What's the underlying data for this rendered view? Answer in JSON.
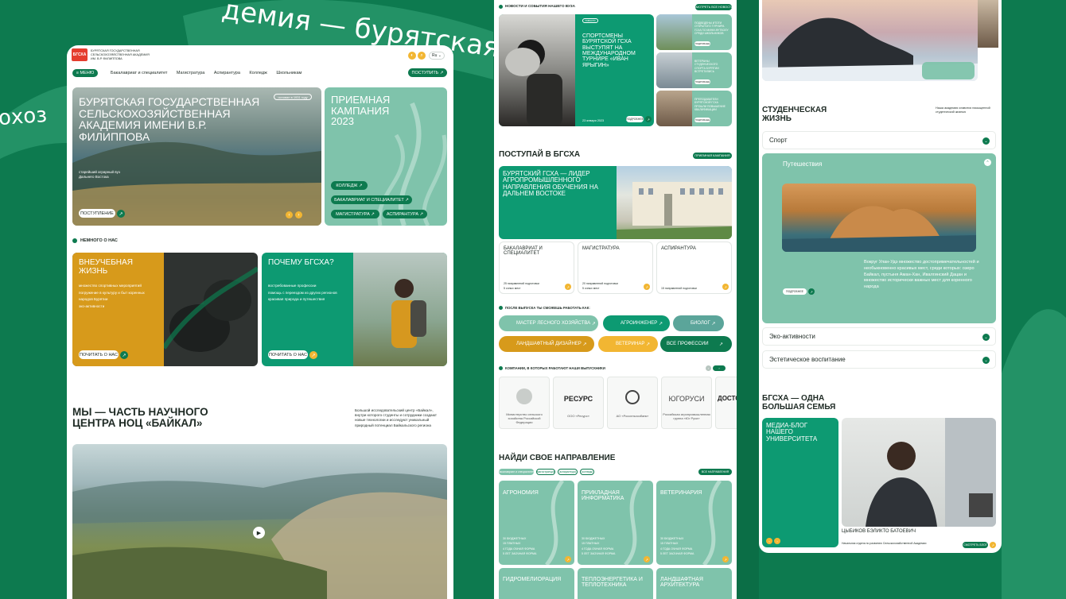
{
  "background": {
    "slogan_top": "демия — бурятская го",
    "slogan_left": "охоз"
  },
  "site": {
    "name_line1": "БУРЯТСКАЯ ГОСУДАРСТВЕННАЯ",
    "name_line2": "СЕЛЬСКОХОЗЯЙСТВЕННАЯ АКАДЕМИЯ",
    "name_line3": "ИМ. В.Р. ФИЛИППОВА",
    "logo_text": "БГСХА",
    "lang": "Ru",
    "accent": "#0d7a4f",
    "orange": "#f2b632",
    "mint": "#7fc3ab"
  },
  "header": {
    "menu_label": "МЕНЮ",
    "nav": [
      "Бакалавриат и специалитет",
      "Магистратура",
      "Аспирантура",
      "Колледж",
      "Школьникам"
    ],
    "apply_label": "ПОСТУПИТЬ"
  },
  "hero": {
    "title": "БУРЯТСКАЯ ГОСУДАРСТВЕННАЯ СЕЛЬСКОХОЗЯЙСТВЕННАЯ АКАДЕМИЯ ИМЕНИ В.Р. ФИЛИППОВА",
    "subtitle": "старейший аграрный вуз Дальнего Востока",
    "badge": "основан в 1931 году",
    "button": "ПОСТУПЛЕНИЕ"
  },
  "campaign": {
    "title": "ПРИЕМНАЯ КАМПАНИЯ 2023",
    "buttons": [
      "КОЛЛЕДЖ",
      "БАКАЛАВРИАТ И СПЕЦИАЛИТЕТ",
      "МАГИСТРАТУРА",
      "АСПИРАНТУРА"
    ]
  },
  "about": {
    "label": "НЕМНОГО О НАС",
    "card1": {
      "title": "ВНЕУЧЕБНАЯ ЖИЗНЬ",
      "items": [
        "множество спортивных мероприятий",
        "погружение в культуру и быт коренных народов Бурятии",
        "эко-активности"
      ],
      "button": "ПОЧИТАТЬ О НАС"
    },
    "card2": {
      "title": "ПОЧЕМУ БГСХА?",
      "items": [
        "востребованные профессии",
        "помощь с переездом из других регионов",
        "красивая природа и путешествия"
      ],
      "button": "ПОЧИТАТЬ О НАС"
    }
  },
  "science": {
    "title": "МЫ — ЧАСТЬ НАУЧНОГО ЦЕНТРА НОЦ «БАЙКАЛ»",
    "text": "Большой исследовательский центр «Байкал», внутри которого студенты и сотрудники создают новые технологии и исследуют уникальный природный потенциал Байкальского региона"
  },
  "news": {
    "label": "НОВОСТИ И СОБЫТИЯ НАШЕГО ВУЗА",
    "all_button": "СМОТРЕТЬ ВСЕ НОВОСТИ",
    "main_tag": "новости",
    "main_title": "СПОРТСМЕНЫ БУРЯТСКОЙ ГСХА ВЫСТУПЯТ НА МЕЖДУНАРОДНОМ ТУРНИРЕ «ИВАН ЯРЫГИН»",
    "main_date": "23 января 2023",
    "main_button": "ПОДРОБНЕЕ",
    "side": [
      {
        "title": "ПОДВЕДЕНЫ ИТОГИ ОТКРЫТОГО ТУРНИРА ГСХА ПО МИНИ-ФУТБОЛУ СРЕДИ ШКОЛЬНИКОВ",
        "button": "ПОДРОБНЕЕ"
      },
      {
        "title": "ВЕТЕРАНЫ СТУДЕНЧЕСКОГО СПОРТА БУРЯТИИ ВСТРЕТИЛИСЬ",
        "button": "ПОДРОБНЕЕ"
      },
      {
        "title": "ПРЕПОДАВАТЕЛИ БУРЯТСКОЙ ГСХА ПРОШЛИ ПОВЫШЕНИЕ КВАЛИФИКАЦИИ",
        "button": "ПОДРОБНЕЕ"
      }
    ]
  },
  "admission": {
    "title": "ПОСТУПАЙ В БГСХА",
    "button": "ПРИЕМНАЯ КАМПАНИЯ",
    "lead_title": "БУРЯТСКИЙ ГСХА — ЛИДЕР АГРОПРОМЫШЛЕННОГО НАПРАВЛЕНИЯ ОБУЧЕНИЯ НА ДАЛЬНЕМ ВОСТОКЕ",
    "levels": [
      {
        "title": "БАКАЛАВРИАТ И СПЕЦИАЛИТЕТ",
        "l1": "25 направлений подготовки",
        "l2": "5 очных мест"
      },
      {
        "title": "МАГИСТРАТУРА",
        "l1": "20 направлений подготовки",
        "l2": "5 очных мест"
      },
      {
        "title": "АСПИРАНТУРА",
        "l1": "15 направлений подготовки"
      }
    ]
  },
  "careers": {
    "label": "ПОСЛЕ ВЫПУСКА ТЫ СМОЖЕШЬ РАБОТАТЬ КАК:",
    "items": [
      "МАСТЕР ЛЕСНОГО ХОЗЯЙСТВА",
      "АГРОИНЖЕНЕР",
      "БИОЛОГ",
      "ЛАНДШАФТНЫЙ ДИЗАЙНЕР",
      "ВЕТЕРИНАР"
    ],
    "all": "ВСЕ ПРОФЕССИИ"
  },
  "companies": {
    "label": "КОМПАНИИ, В КОТОРЫХ РАБОТАЮТ НАШИ ВЫПУСКНИКИ",
    "logos": [
      {
        "name": "",
        "caption": "Министерство сельского хозяйства Российской Федерации"
      },
      {
        "name": "РЕСУРС",
        "caption": "ООО «Ресурс»"
      },
      {
        "name": "",
        "caption": "АО «Россельхозбанк»"
      },
      {
        "name": "ЮГОРУСИ",
        "caption": "Российская агропромышленная группа «Юг Руси»"
      },
      {
        "name": "ДОСТО",
        "caption": ""
      }
    ]
  },
  "directions": {
    "title": "НАЙДИ СВОЕ НАПРАВЛЕНИЕ",
    "filters": [
      "бакалавриат и специалитет",
      "магистратура",
      "аспирантура",
      "колледж"
    ],
    "all_button": "ВСЕ НАПРАВЛЕНИЯ",
    "items": [
      {
        "name": "АГРОНОМИЯ",
        "b1": "30 БЮДЖЕТНЫХ",
        "b2": "15 ПЛАТНЫХ",
        "f1": "4 ГОДА ОЧНАЯ ФОРМА",
        "f2": "5 ЛЕТ ЗАОЧНАЯ ФОРМА"
      },
      {
        "name": "ПРИКЛАДНАЯ ИНФОРМАТИКА",
        "b1": "30 БЮДЖЕТНЫХ",
        "b2": "15 ПЛАТНЫХ",
        "f1": "4 ГОДА ОЧНАЯ ФОРМА",
        "f2": "5 ЛЕТ ЗАОЧНАЯ ФОРМА"
      },
      {
        "name": "ВЕТЕРИНАРИЯ",
        "b1": "30 БЮДЖЕТНЫХ",
        "b2": "15 ПЛАТНЫХ",
        "f1": "4 ГОДА ОЧНАЯ ФОРМА",
        "f2": "5 ЛЕТ ЗАОЧНАЯ ФОРМА"
      },
      {
        "name": "ГИДРОМЕЛИОРАЦИЯ"
      },
      {
        "name": "ТЕПЛОЭНЕРГЕТИКА И ТЕПЛОТЕХНИКА"
      },
      {
        "name": "ЛАНДШАФТНАЯ АРХИТЕКТУРА"
      }
    ]
  },
  "student_life": {
    "title": "СТУДЕНЧЕСКАЯ ЖИЗНЬ",
    "text": "Наша академия славится насыщенной студенческой жизнью",
    "accordion": [
      "Спорт",
      "Путешествия",
      "Эко-активности",
      "Эстетическое воспитание"
    ],
    "travel_text": "Вокруг Улан-Удэ множество достопримечательностей и необыкновенно красивых мест, среди которых: озеро Байкал, пустыня Аман-Хан, Ивалгинский Дацан и множество исторически важных мест для коренного народа",
    "travel_button": "ПОДРОБНЕЕ"
  },
  "family": {
    "title": "БГСХА — ОДНА БОЛЬШАЯ СЕМЬЯ",
    "blog_title": "МЕДИА-БЛОГ НАШЕГО УНИВЕРСИТЕТА",
    "person_name": "ЦЫБИКОВ БЭЛИКТО БАТОЕВИЧ",
    "person_role": "Начальник отдела по развитию Сельскохозяйственной Академии",
    "button": "СМОТРЕТЬ БЛОГ"
  }
}
